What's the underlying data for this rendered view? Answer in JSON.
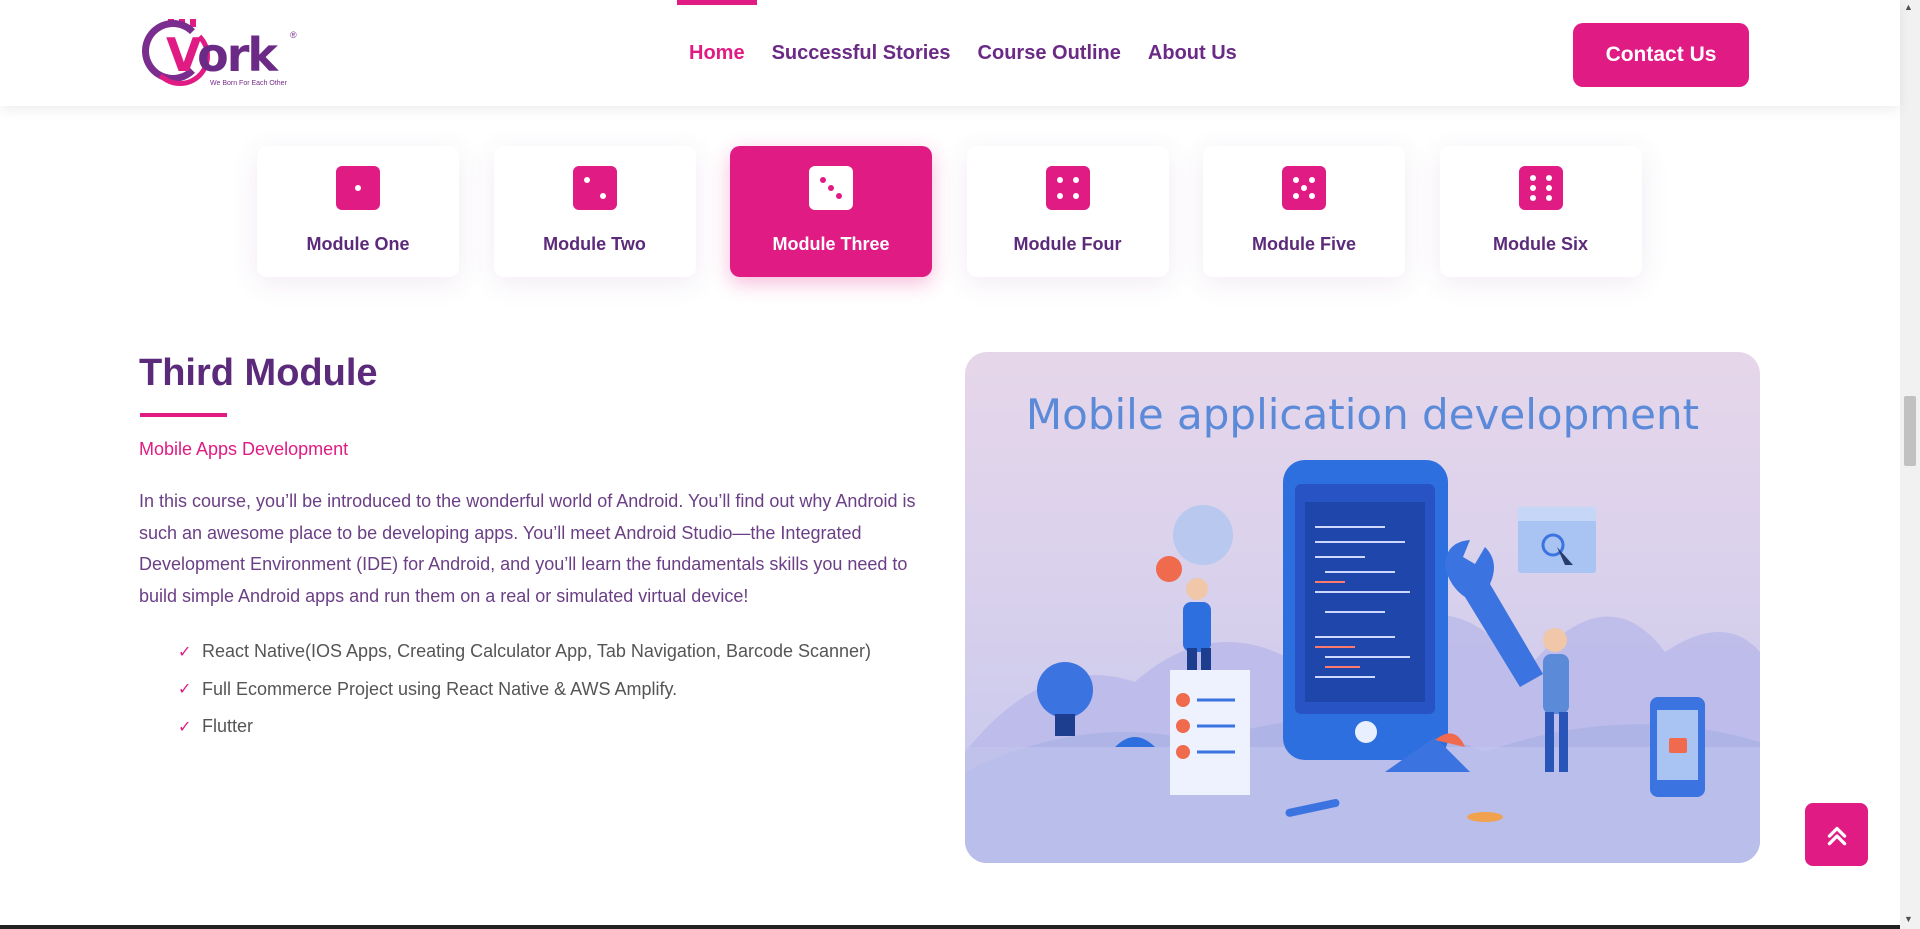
{
  "logo": {
    "text_v": "V",
    "text_rest": "ork",
    "tagline": "We Born For Each Other",
    "reg": "®"
  },
  "nav": [
    {
      "label": "Home",
      "active": true
    },
    {
      "label": "Successful Stories",
      "active": false
    },
    {
      "label": "Course Outline",
      "active": false
    },
    {
      "label": "About Us",
      "active": false
    }
  ],
  "contact_label": "Contact Us",
  "modules": [
    {
      "label": "Module One",
      "pips": 1,
      "active": false
    },
    {
      "label": "Module Two",
      "pips": 2,
      "active": false
    },
    {
      "label": "Module Three",
      "pips": 3,
      "active": true
    },
    {
      "label": "Module Four",
      "pips": 4,
      "active": false
    },
    {
      "label": "Module Five",
      "pips": 5,
      "active": false
    },
    {
      "label": "Module Six",
      "pips": 6,
      "active": false
    }
  ],
  "content": {
    "title": "Third Module",
    "subtitle": "Mobile Apps Development",
    "description": "In this course, you’ll be introduced to the wonderful world of Android. You’ll find out why Android is such an awesome place to be developing apps. You’ll meet Android Studio—the Integrated Development Environment (IDE) for Android, and you’ll learn the fundamentals skills you need to build simple Android apps and run them on a real or simulated virtual device!",
    "topics": [
      "React Native(IOS Apps, Creating Calculator App, Tab Navigation, Barcode Scanner)",
      "Full Ecommerce Project using React Native & AWS Amplify.",
      "Flutter"
    ]
  },
  "illustration": {
    "title": "Mobile application development"
  },
  "colors": {
    "accent": "#e01b84",
    "brand": "#5b2a7a",
    "illus_title": "#5b8ad8"
  }
}
